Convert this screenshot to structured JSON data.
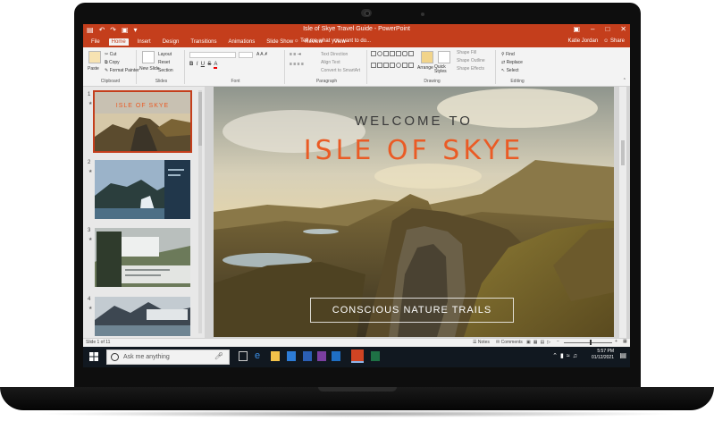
{
  "app": {
    "window_title": "Isle of Skye Travel Guide - PowerPoint"
  },
  "tabs": [
    "File",
    "Home",
    "Insert",
    "Design",
    "Transitions",
    "Animations",
    "Slide Show",
    "Review",
    "View"
  ],
  "active_tab": "Home",
  "tell_me": "Tell me what you want to do...",
  "user": {
    "name": "Katie Jordan",
    "share": "Share"
  },
  "ribbon": {
    "clipboard": {
      "paste": "Paste",
      "cut": "Cut",
      "copy": "Copy",
      "format_painter": "Format Painter",
      "label": "Clipboard"
    },
    "slides": {
      "new_slide": "New Slide",
      "layout": "Layout",
      "reset": "Reset",
      "section": "Section",
      "label": "Slides"
    },
    "font": {
      "label": "Font",
      "bold": "B",
      "italic": "I",
      "underline": "U",
      "strike": "S"
    },
    "paragraph": {
      "text_direction": "Text Direction",
      "align_text": "Align Text",
      "smartart": "Convert to SmartArt",
      "label": "Paragraph"
    },
    "drawing": {
      "arrange": "Arrange",
      "quick_styles": "Quick Styles",
      "shape_fill": "Shape Fill",
      "shape_outline": "Shape Outline",
      "shape_effects": "Shape Effects",
      "label": "Drawing"
    },
    "editing": {
      "find": "Find",
      "replace": "Replace",
      "select": "Select",
      "label": "Editing"
    }
  },
  "thumbnails": [
    {
      "num": "1",
      "title": "ISLE OF SKYE"
    },
    {
      "num": "2"
    },
    {
      "num": "3"
    },
    {
      "num": "4"
    }
  ],
  "slide": {
    "welcome": "WELCOME TO",
    "title": "ISLE OF SKYE",
    "subtitle": "CONSCIOUS NATURE TRAILS"
  },
  "status": {
    "slide_count": "Slide 1 of 11",
    "notes": "Notes",
    "comments": "Comments"
  },
  "taskbar": {
    "search_placeholder": "Ask me anything",
    "time": "5:57 PM",
    "date": "01/12/2021"
  },
  "colors": {
    "accent": "#c43e1c",
    "slide_title": "#ea5b25"
  }
}
